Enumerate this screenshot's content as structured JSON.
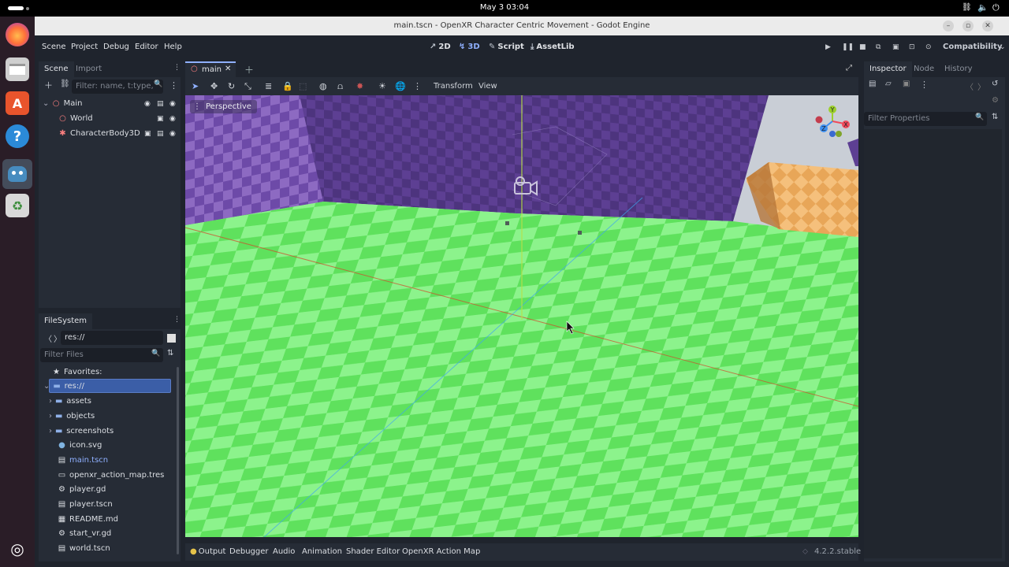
{
  "system": {
    "datetime": "May 3  03:04"
  },
  "window": {
    "title": "main.tscn - OpenXR Character Centric Movement - Godot Engine"
  },
  "menu": [
    "Scene",
    "Project",
    "Debug",
    "Editor",
    "Help"
  ],
  "workspaces": {
    "w2d": "2D",
    "w3d": "3D",
    "script": "Script",
    "assetlib": "AssetLib"
  },
  "renderer": "Compatibility",
  "scene_panel": {
    "tabs": [
      "Scene",
      "Import"
    ],
    "filter_placeholder": "Filter: name, t:type,",
    "nodes": [
      {
        "name": "Main",
        "type": "node3d"
      },
      {
        "name": "World",
        "type": "node3d"
      },
      {
        "name": "CharacterBody3D",
        "type": "character"
      }
    ]
  },
  "filesystem": {
    "tab": "FileSystem",
    "path": "res://",
    "filter_placeholder": "Filter Files",
    "favorites": "Favorites:",
    "root": "res://",
    "items": [
      {
        "name": "assets",
        "kind": "folder"
      },
      {
        "name": "objects",
        "kind": "folder"
      },
      {
        "name": "screenshots",
        "kind": "folder"
      },
      {
        "name": "icon.svg",
        "kind": "image"
      },
      {
        "name": "main.tscn",
        "kind": "scene"
      },
      {
        "name": "openxr_action_map.tres",
        "kind": "resource"
      },
      {
        "name": "player.gd",
        "kind": "script"
      },
      {
        "name": "player.tscn",
        "kind": "scene"
      },
      {
        "name": "README.md",
        "kind": "text"
      },
      {
        "name": "start_vr.gd",
        "kind": "script"
      },
      {
        "name": "world.tscn",
        "kind": "scene"
      }
    ]
  },
  "editor_tab": "main",
  "viewport": {
    "toolbar": {
      "transform": "Transform",
      "view": "View"
    },
    "perspective": "Perspective",
    "gizmo": {
      "y": "Y",
      "x": "X",
      "z": "Z"
    }
  },
  "bottom": {
    "tabs": [
      "Output",
      "Debugger",
      "Audio",
      "Animation",
      "Shader Editor",
      "OpenXR Action Map"
    ],
    "version": "4.2.2.stable"
  },
  "inspector": {
    "tabs": [
      "Inspector",
      "Node",
      "History"
    ],
    "filter_placeholder": "Filter Properties"
  },
  "colors": {
    "accent": "#8fb0ff",
    "ground_light": "#8ef58e",
    "ground_dark": "#5de55b",
    "wall": "#5b3f91",
    "highlight": "#3b5ea7"
  }
}
